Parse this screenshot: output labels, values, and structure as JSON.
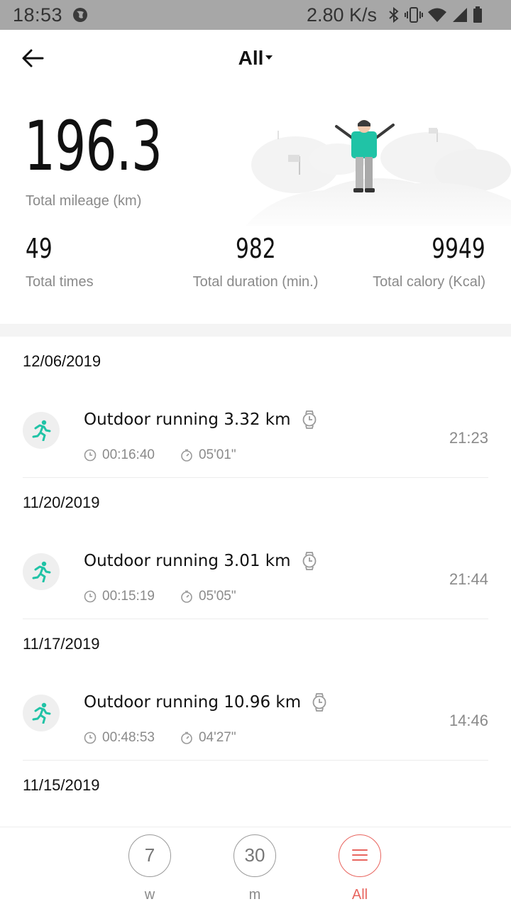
{
  "status_bar": {
    "time": "18:53",
    "network_speed": "2.80 K/s",
    "icons": [
      "globe-icon",
      "bluetooth-icon",
      "vibrate-icon",
      "wifi-icon",
      "cell-signal-icon",
      "battery-icon"
    ]
  },
  "header": {
    "filter_label": "All"
  },
  "summary": {
    "total_mileage": "196.3",
    "total_mileage_label": "Total mileage (km)",
    "stats": [
      {
        "value": "49",
        "label": "Total times"
      },
      {
        "value": "982",
        "label": "Total duration (min.)"
      },
      {
        "value": "9949",
        "label": "Total calory (Kcal)"
      }
    ]
  },
  "records": [
    {
      "date": "12/06/2019",
      "title": "Outdoor running 3.32 km",
      "duration": "00:16:40",
      "pace": "05'01\"",
      "time": "21:23"
    },
    {
      "date": "11/20/2019",
      "title": "Outdoor running 3.01 km",
      "duration": "00:15:19",
      "pace": "05'05\"",
      "time": "21:44"
    },
    {
      "date": "11/17/2019",
      "title": "Outdoor running 10.96 km",
      "duration": "00:48:53",
      "pace": "04'27\"",
      "time": "14:46"
    },
    {
      "date": "11/15/2019"
    }
  ],
  "bottom_bar": {
    "week": {
      "number": "7",
      "caption": "w"
    },
    "month": {
      "number": "30",
      "caption": "m"
    },
    "all": {
      "caption": "All"
    }
  },
  "colors": {
    "accent_teal": "#20c3a6",
    "accent_red": "#e8655f",
    "muted_text": "#8a8a8a",
    "status_bar_bg": "#a7a7a7"
  }
}
